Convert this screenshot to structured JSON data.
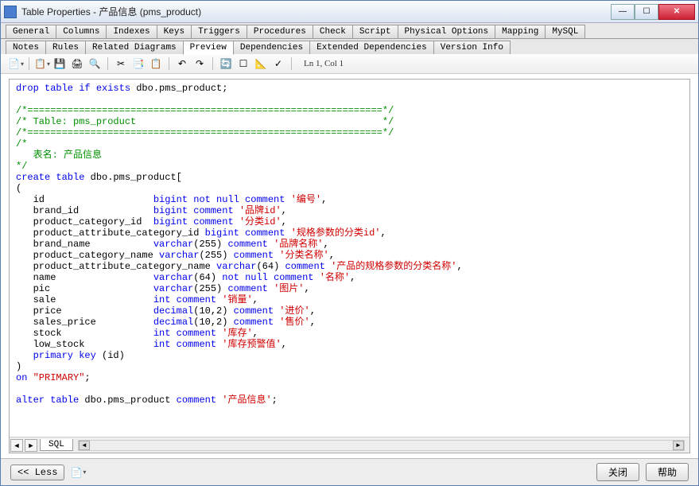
{
  "title": "Table Properties - 产品信息 (pms_product)",
  "tabs1": [
    "General",
    "Columns",
    "Indexes",
    "Keys",
    "Triggers",
    "Procedures",
    "Check",
    "Script",
    "Physical Options",
    "Mapping",
    "MySQL"
  ],
  "tabs2": [
    "Notes",
    "Rules",
    "Related Diagrams",
    "Preview",
    "Dependencies",
    "Extended Dependencies",
    "Version Info"
  ],
  "active_tab": "Preview",
  "status": "Ln 1, Col 1",
  "bottom_tab": "SQL",
  "footer": {
    "less": "<< Less",
    "close": "关闭",
    "help": "帮助"
  },
  "code": {
    "l1a": "drop table if exists",
    "l1b": " dbo.pms_product;",
    "l2": "/*==============================================================*/",
    "l3": "/* Table: pms_product                                           */",
    "l4": "/*==============================================================*/",
    "l5": "/*",
    "l6": "   表名: 产品信息",
    "l7": "*/",
    "l8a": "create table",
    "l8b": " dbo.pms_product[",
    "l9": "(",
    "c1a": "   id                   ",
    "c1b": "bigint not null comment ",
    "c1c": "'编号'",
    "comma": ",",
    "c2a": "   brand_id             ",
    "c2b": "bigint comment ",
    "c2c": "'品牌id'",
    "c3a": "   product_category_id  ",
    "c3b": "bigint comment ",
    "c3c": "'分类id'",
    "c4a": "   product_attribute_category_id ",
    "c4b": "bigint comment ",
    "c4c": "'规格参数的分类id'",
    "c5a": "   brand_name           ",
    "c5b": "varchar",
    "c5p": "(255) ",
    "c5d": "comment ",
    "c5c": "'品牌名称'",
    "c6a": "   product_category_name ",
    "c6b": "varchar",
    "c6p": "(255) ",
    "c6d": "comment ",
    "c6c": "'分类名称'",
    "c7a": "   product_attribute_category_name ",
    "c7b": "varchar",
    "c7p": "(64) ",
    "c7d": "comment ",
    "c7c": "'产品的规格参数的分类名称'",
    "c8a": "   name                 ",
    "c8b": "varchar",
    "c8p": "(64) ",
    "c8d": "not null comment ",
    "c8c": "'名称'",
    "c9a": "   pic                  ",
    "c9b": "varchar",
    "c9p": "(255) ",
    "c9d": "comment ",
    "c9c": "'图片'",
    "c10a": "   sale                 ",
    "c10b": "int comment ",
    "c10c": "'销量'",
    "c11a": "   price                ",
    "c11b": "decimal",
    "c11p": "(10,2) ",
    "c11d": "comment ",
    "c11c": "'进价'",
    "c12a": "   sales_price          ",
    "c12b": "decimal",
    "c12p": "(10,2) ",
    "c12d": "comment ",
    "c12c": "'售价'",
    "c13a": "   stock                ",
    "c13b": "int comment ",
    "c13c": "'库存'",
    "c14a": "   low_stock            ",
    "c14b": "int comment ",
    "c14c": "'库存预警值'",
    "c15a": "   primary key",
    "c15b": " (id)",
    "l10": ")",
    "l11a": "on ",
    "l11b": "\"PRIMARY\"",
    "l11c": ";",
    "l12a": "alter table",
    "l12b": " dbo.pms_product ",
    "l12c": "comment ",
    "l12d": "'产品信息'",
    "l12e": ";"
  }
}
